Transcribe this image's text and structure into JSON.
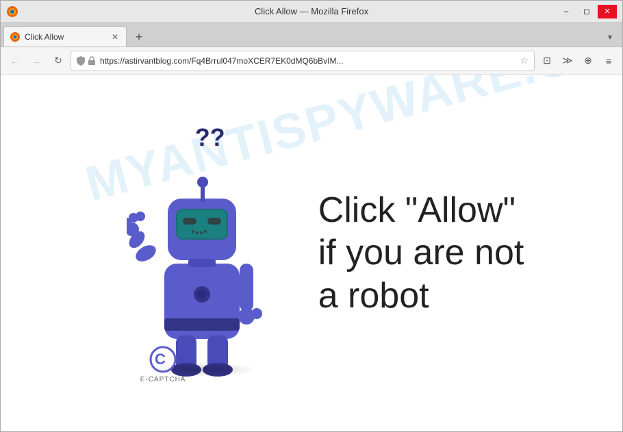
{
  "window": {
    "title": "Click Allow — Mozilla Firefox"
  },
  "titlebar": {
    "title": "Click Allow — Mozilla Firefox",
    "minimize_label": "–",
    "restore_label": "◻",
    "close_label": "✕"
  },
  "tab": {
    "label": "Click Allow",
    "close_label": "✕",
    "new_tab_label": "+",
    "dropdown_label": "▾"
  },
  "navbar": {
    "back_label": "←",
    "forward_label": "→",
    "reload_label": "↻",
    "url": "https://astirvantblog.com/Fq4Brrul047moXCER7EK0dMQ6bBvIM...",
    "url_full": "https://astirvantblog.com/Fq4Brrul047moXCER7EK0dMQ6bBvIM",
    "star_label": "☆",
    "pocket_label": "⊡",
    "extensions_label": "≫",
    "addons_label": "⊕",
    "menu_label": "≡"
  },
  "content": {
    "watermark": "MYANTISPYWARE.COM",
    "question_marks": "??",
    "main_line1": "Click \"Allow\"",
    "main_line2": "if you are not",
    "main_line3": "a robot",
    "ecaptcha_label": "E-CAPTCHA"
  },
  "colors": {
    "robot_body": "#5B5CCC",
    "robot_dark": "#4040AA",
    "robot_visor": "#1a6060",
    "accent": "#0078d7",
    "firefox_orange": "#e8650a"
  }
}
